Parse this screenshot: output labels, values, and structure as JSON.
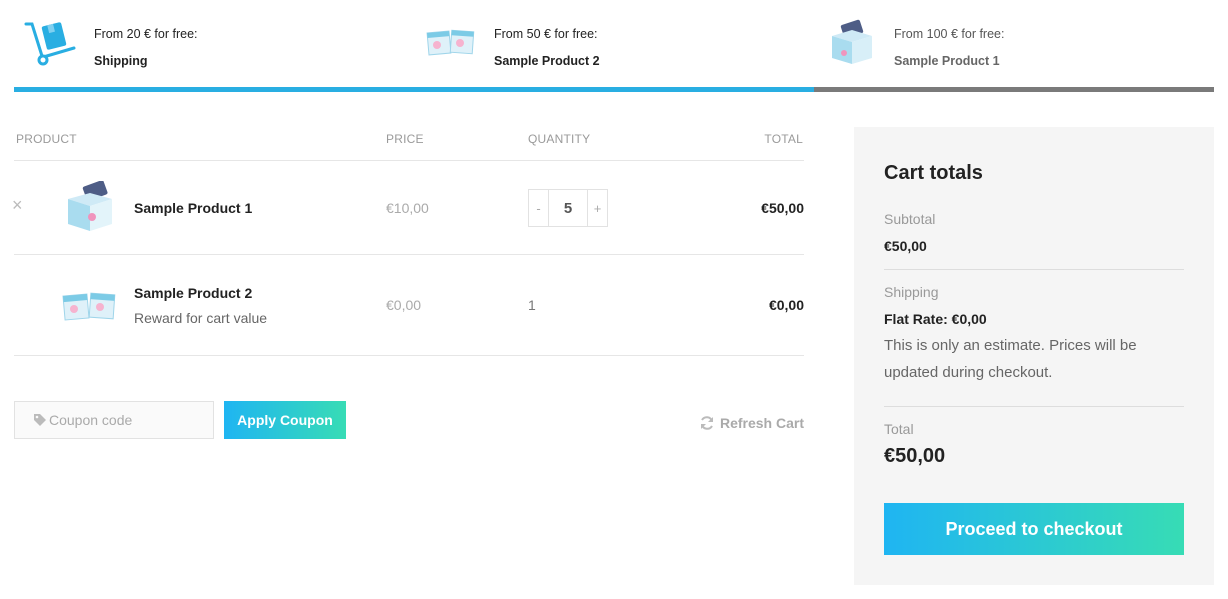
{
  "gifts": [
    {
      "requirement": "From 20 € for free:",
      "name": "Shipping",
      "icon": "hand-truck-icon"
    },
    {
      "requirement": "From 50 € for free:",
      "name": "Sample Product 2",
      "icon": "sample-cards-icon"
    },
    {
      "requirement": "From 100 € for free:",
      "name": "Sample Product 1",
      "icon": "sample-box-icon"
    }
  ],
  "progress": {
    "reached_tiers": 2,
    "total_tiers": 3
  },
  "cart": {
    "headers": {
      "product": "PRODUCT",
      "price": "PRICE",
      "quantity": "QUANTITY",
      "total": "TOTAL"
    },
    "items": [
      {
        "name": "Sample Product 1",
        "price": "€10,00",
        "quantity": "5",
        "total": "€50,00",
        "minus": "-",
        "plus": "+"
      },
      {
        "name": "Sample Product 2",
        "note": "Reward for cart value",
        "price": "€0,00",
        "quantity": "1",
        "total": "€0,00"
      }
    ],
    "coupon_placeholder": "Coupon code",
    "apply_label": "Apply Coupon",
    "refresh_label": "Refresh Cart"
  },
  "totals": {
    "title": "Cart totals",
    "subtotal_label": "Subtotal",
    "subtotal_value": "€50,00",
    "shipping_label": "Shipping",
    "shipping_value": "Flat Rate: €0,00",
    "shipping_note": "This is only an estimate. Prices will be updated during checkout.",
    "total_label": "Total",
    "total_value": "€50,00",
    "checkout_label": "Proceed to checkout"
  },
  "colors": {
    "accent": "#29aee2",
    "gradient_start": "#1fb5f2",
    "gradient_end": "#37dcb5",
    "progress_remaining": "#7a7a7a"
  }
}
